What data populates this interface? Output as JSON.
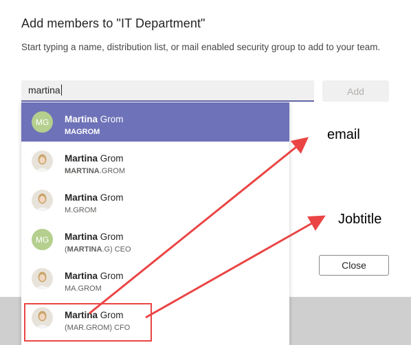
{
  "dialog": {
    "title": "Add members to \"IT Department\"",
    "description": "Start typing a name, distribution list, or mail enabled security group to add to your team.",
    "search_value": "martina",
    "add_label": "Add",
    "close_label": "Close"
  },
  "suggestions": [
    {
      "name_bold": "Martina",
      "name_rest": " Grom",
      "sub_bold": "",
      "sub_parts": [
        "MAGROM"
      ],
      "avatar": "MG",
      "avatar_type": "initials",
      "active": true
    },
    {
      "name_bold": "Martina",
      "name_rest": " Grom",
      "sub_bold": "MARTINA",
      "sub_rest": ".GROM",
      "avatar_type": "photo"
    },
    {
      "name_bold": "Martina",
      "name_rest": " Grom",
      "sub_plain": "M.GROM",
      "avatar_type": "photo"
    },
    {
      "name_bold": "Martina",
      "name_rest": " Grom",
      "sub_pre": "(",
      "sub_bold": "MARTINA",
      "sub_rest": ".G) CEO",
      "avatar": "MG",
      "avatar_type": "initials"
    },
    {
      "name_bold": "Martina",
      "name_rest": " Grom",
      "sub_plain": "MA.GROM",
      "avatar_type": "photo"
    },
    {
      "name_bold": "Martina",
      "name_rest": " Grom",
      "sub_plain": "(MAR.GROM) CFO",
      "avatar_type": "photo"
    }
  ],
  "annotations": {
    "email_label": "email",
    "jobtitle_label": "Jobtitle",
    "arrow_color": "#ea4444"
  }
}
